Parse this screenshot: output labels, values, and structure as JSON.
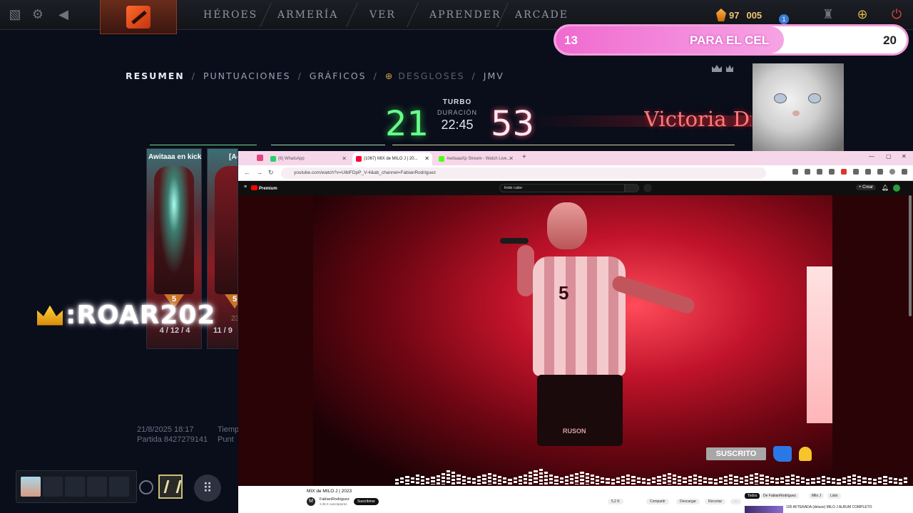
{
  "topbar": {
    "nav": [
      "HÉROES",
      "ARMERÍA",
      "VER",
      "APRENDER",
      "ARCADE"
    ],
    "currency_a": "97",
    "currency_b": "005",
    "notification_count": "1"
  },
  "goal": {
    "current": "13",
    "label": "PARA EL CEL",
    "target": "20",
    "progress_fraction": 0.65
  },
  "match": {
    "tabs": [
      "RESUMEN",
      "PUNTUACIONES",
      "GRÁFICOS",
      "DESGLOSES",
      "JMV"
    ],
    "separator": "/",
    "radiant_score": "21",
    "dire_score": "53",
    "mode": "TURBO",
    "duration_label": "DURACIÓN",
    "duration": "22:45",
    "result": "Victoria Di",
    "date": "21/8/2025 18:17",
    "match_id": "Partida 8427279141",
    "time_label": "Tiemp",
    "score_label": "Punt",
    "heroes": [
      {
        "name": "Awitaaa en kick",
        "rank": "5",
        "kda": "4 / 12 / 4"
      },
      {
        "name": "[A-",
        "rank": "5",
        "extra": "23",
        "kda": "11 / 9"
      }
    ]
  },
  "overlay": {
    "username": ":ROAR202"
  },
  "browser": {
    "tabs": [
      {
        "title": "(6) WhatsApp",
        "color": "#25d366"
      },
      {
        "title": "(1067) MIX de MILO J | 20...",
        "color": "#ff0033"
      },
      {
        "title": "AwitaaaXp Stream - Watch Live...",
        "color": "#53fc18"
      }
    ],
    "new_tab": "+",
    "url": "youtube.com/watch?v=UiblFDpP_V-4&ab_channel=FabianRodriguez",
    "yt": {
      "logo": "Premium",
      "search_value": "linde cabe",
      "create": "+ Crear"
    },
    "video": {
      "title": "MIX de MILO J | 2023",
      "channel": "FabianRodriguez",
      "channel_initial": "M",
      "subscribers": "2,36 K suscriptores",
      "subscribed": "Suscribirse",
      "likes": "5,2 K",
      "share": "Compartir",
      "download": "Descargar",
      "remix": "Recortar",
      "more": "···",
      "shirt_number": "5",
      "shorts_brand": "RUSON"
    },
    "chips": [
      "Todos",
      "De FabianRodriguez",
      "Milo J",
      "Listo"
    ],
    "reco_title": "105 AFTERADA (deluxe) MILO J ALBUM COMPLETO",
    "overlay_subscribed": "SUSCRITO"
  },
  "colors": {
    "radiant": "#67ff8a",
    "dire": "#ffe9f0",
    "victory": "#ff7a7a",
    "goal_fill": "#f06ad0"
  }
}
